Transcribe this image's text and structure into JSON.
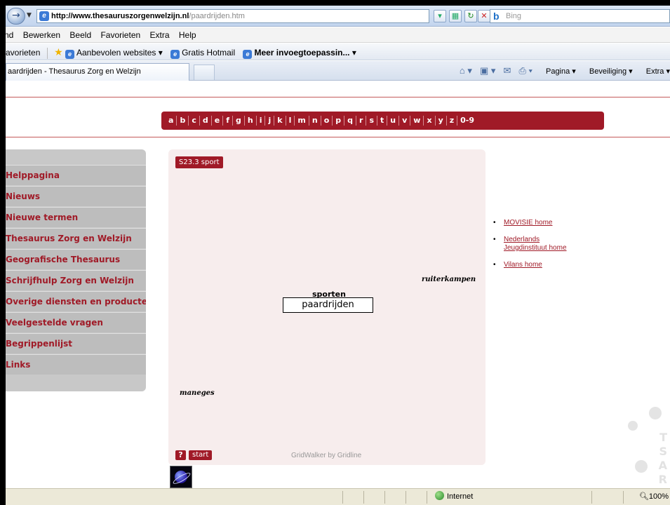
{
  "browser": {
    "url_host": "http://www.thesauruszorgenwelzijn.nl",
    "url_path": "/paardrijden.htm",
    "search_placeholder": "Bing",
    "menu": [
      "nd",
      "Bewerken",
      "Beeld",
      "Favorieten",
      "Extra",
      "Help"
    ],
    "favorites_label": "avorieten",
    "favorites_items": [
      "Aanbevolen websites",
      "Gratis Hotmail",
      "Meer invoegtoepassin..."
    ],
    "tab_title": "aardrijden - Thesaurus Zorg en Welzijn",
    "commands": [
      "Pagina",
      "Beveiliging",
      "Extra"
    ],
    "status_zone": "Internet",
    "zoom": "100%"
  },
  "alphabet": [
    "a",
    "b",
    "c",
    "d",
    "e",
    "f",
    "g",
    "h",
    "i",
    "j",
    "k",
    "l",
    "m",
    "n",
    "o",
    "p",
    "q",
    "r",
    "s",
    "t",
    "u",
    "v",
    "w",
    "x",
    "y",
    "z",
    "0-9"
  ],
  "sidebar": {
    "items": [
      "Helppagina",
      "Nieuws",
      "Nieuwe termen",
      "Thesaurus Zorg en Welzijn",
      "Geografische Thesaurus",
      "Schrijfhulp Zorg en Welzijn",
      "Overige diensten en producten",
      "Veelgestelde vragen",
      "Begrippenlijst",
      "Links"
    ]
  },
  "grid": {
    "tag": "S23.3 sport",
    "broader": "sporten",
    "current_term": "paardrijden",
    "related_right": "ruiterkampen",
    "related_bottom": "maneges",
    "help_label": "?",
    "start_label": "start",
    "credit": "GridWalker by Gridline"
  },
  "links": [
    "MOVISIE home",
    "Nederlands Jeugdinstituut home",
    "Vilans home"
  ],
  "colors": {
    "brand": "#a01a27",
    "sidebar_bg": "#c8c8c8",
    "grid_bg": "#f7eded"
  }
}
